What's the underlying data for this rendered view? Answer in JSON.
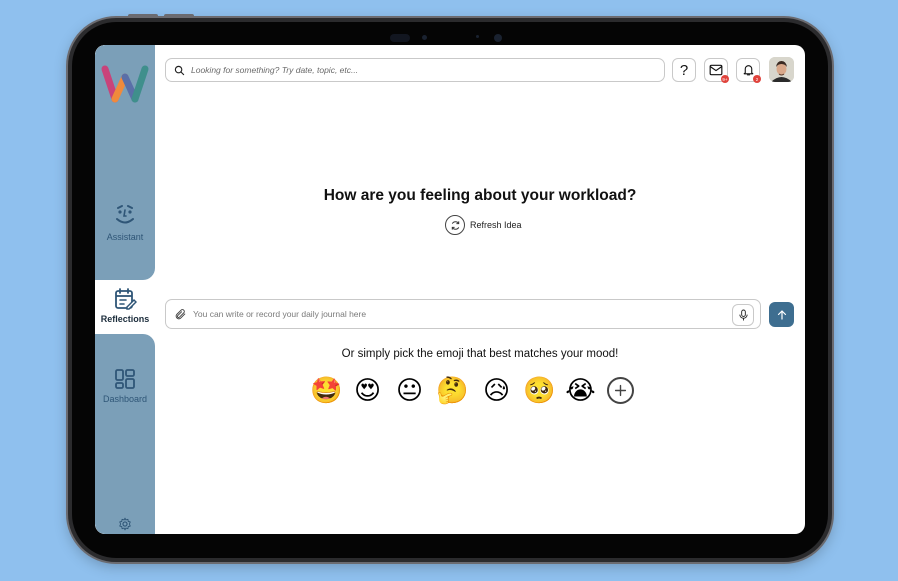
{
  "sidebar": {
    "items": [
      {
        "id": "assistant",
        "label": "Assistant",
        "icon": "assistant-face-icon"
      },
      {
        "id": "reflections",
        "label": "Reflections",
        "icon": "journal-edit-icon",
        "active": true
      },
      {
        "id": "dashboard",
        "label": "Dashboard",
        "icon": "dashboard-grid-icon"
      }
    ],
    "settings_icon": "gear-icon",
    "logo_icon": "w-logo-icon"
  },
  "header": {
    "search_placeholder": "Looking for something? Try date, topic, etc...",
    "help_label": "?",
    "mail_badge": "9+",
    "notification_badge": "2"
  },
  "main": {
    "prompt_question": "How are you feeling about your workload?",
    "refresh_label": "Refresh Idea",
    "journal_placeholder": "You can write or record your daily journal here",
    "emoji_prompt": "Or simply pick the emoji that best matches your mood!",
    "emojis": [
      {
        "name": "star-struck",
        "glyph": "🤩"
      },
      {
        "name": "heart-eyes",
        "glyph": "😍"
      },
      {
        "name": "neutral",
        "glyph": "😐"
      },
      {
        "name": "thinking",
        "glyph": "🤔"
      },
      {
        "name": "sad-sweat",
        "glyph": "😥"
      },
      {
        "name": "pleading",
        "glyph": "🥺"
      },
      {
        "name": "crying",
        "glyph": "😭"
      }
    ]
  },
  "colors": {
    "sidebar": "#7b9fb8",
    "accent": "#3e6e90",
    "background": "#8fc0ee",
    "badge": "#e0433c"
  }
}
